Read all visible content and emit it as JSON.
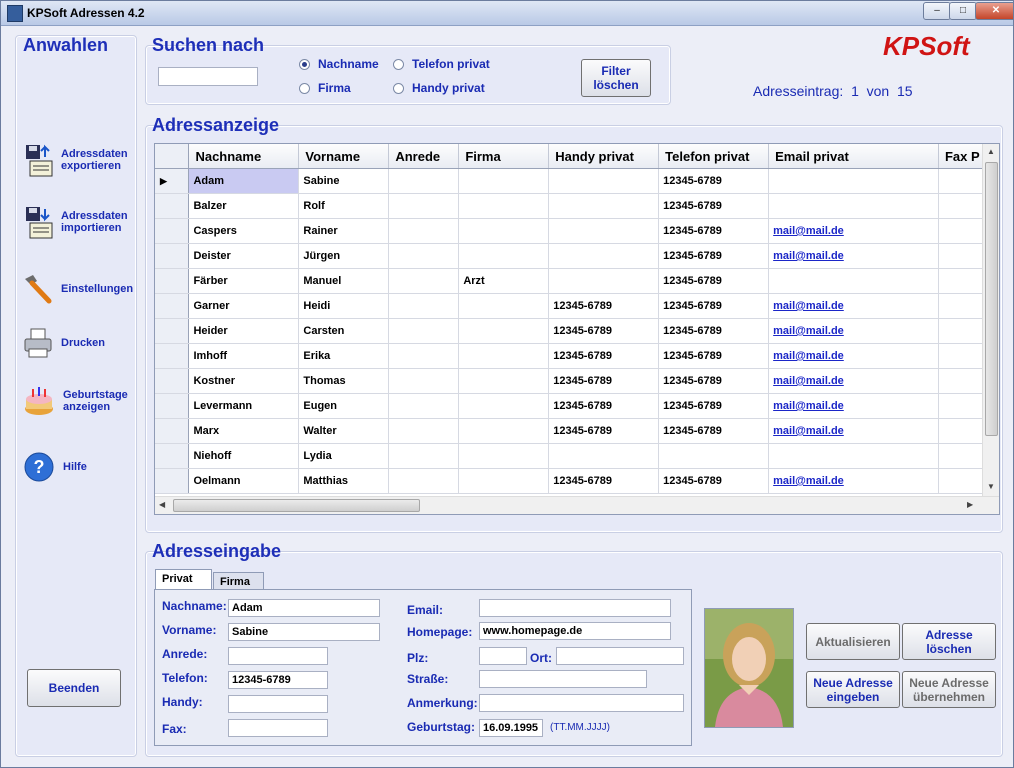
{
  "window": {
    "title": "KPSoft Adressen 4.2",
    "minimize": "–",
    "maximize": "□",
    "close": "✕"
  },
  "sidebar": {
    "title": "Anwahlen",
    "items": [
      {
        "label": "Adressdaten\nexportieren",
        "icon": "export-icon"
      },
      {
        "label": "Adressdaten\nimportieren",
        "icon": "import-icon"
      },
      {
        "label": "Einstellungen",
        "icon": "hammer-icon"
      },
      {
        "label": "Drucken",
        "icon": "printer-icon"
      },
      {
        "label": "Geburtstage\nanzeigen",
        "icon": "birthday-cake-icon"
      },
      {
        "label": "Hilfe",
        "icon": "help-icon"
      }
    ],
    "exit_label": "Beenden"
  },
  "search": {
    "title": "Suchen nach",
    "value": "",
    "radios": [
      {
        "label": "Nachname",
        "checked": true
      },
      {
        "label": "Telefon privat",
        "checked": false
      },
      {
        "label": "Firma",
        "checked": false
      },
      {
        "label": "Handy privat",
        "checked": false
      }
    ],
    "filter_clear_label": "Filter\nlöschen"
  },
  "brand": {
    "logo": "KPSoft",
    "color": "#d01414"
  },
  "record": {
    "label": "Adresseintrag:",
    "current": "1",
    "of_label": "von",
    "total": "15"
  },
  "display": {
    "title": "Adressanzeige",
    "columns": [
      "Nachname",
      "Vorname",
      "Anrede",
      "Firma",
      "Handy privat",
      "Telefon privat",
      "Email privat",
      "Fax P"
    ],
    "rows": [
      [
        "Adam",
        "Sabine",
        "",
        "",
        "",
        "12345-6789",
        "",
        ""
      ],
      [
        "Balzer",
        "Rolf",
        "",
        "",
        "",
        "12345-6789",
        "",
        ""
      ],
      [
        "Caspers",
        "Rainer",
        "",
        "",
        "",
        "12345-6789",
        "mail@mail.de",
        ""
      ],
      [
        "Deister",
        "Jürgen",
        "",
        "",
        "",
        "12345-6789",
        "mail@mail.de",
        ""
      ],
      [
        "Färber",
        "Manuel",
        "",
        "Arzt",
        "",
        "12345-6789",
        "",
        ""
      ],
      [
        "Garner",
        "Heidi",
        "",
        "",
        "12345-6789",
        "12345-6789",
        "mail@mail.de",
        ""
      ],
      [
        "Heider",
        "Carsten",
        "",
        "",
        "12345-6789",
        "12345-6789",
        "mail@mail.de",
        ""
      ],
      [
        "Imhoff",
        "Erika",
        "",
        "",
        "12345-6789",
        "12345-6789",
        "mail@mail.de",
        ""
      ],
      [
        "Kostner",
        "Thomas",
        "",
        "",
        "12345-6789",
        "12345-6789",
        "mail@mail.de",
        ""
      ],
      [
        "Levermann",
        "Eugen",
        "",
        "",
        "12345-6789",
        "12345-6789",
        "mail@mail.de",
        ""
      ],
      [
        "Marx",
        "Walter",
        "",
        "",
        "12345-6789",
        "12345-6789",
        "mail@mail.de",
        ""
      ],
      [
        "Niehoff",
        "Lydia",
        "",
        "",
        "",
        "",
        "",
        ""
      ],
      [
        "Oelmann",
        "Matthias",
        "",
        "",
        "12345-6789",
        "12345-6789",
        "mail@mail.de",
        ""
      ]
    ]
  },
  "entry": {
    "title": "Adresseingabe",
    "tabs": [
      "Privat",
      "Firma"
    ],
    "labels": {
      "nachname": "Nachname:",
      "vorname": "Vorname:",
      "anrede": "Anrede:",
      "telefon": "Telefon:",
      "handy": "Handy:",
      "fax": "Fax:",
      "email": "Email:",
      "homepage": "Homepage:",
      "plz": "Plz:",
      "ort": "Ort:",
      "strasse": "Straße:",
      "anmerkung": "Anmerkung:",
      "geburtstag": "Geburtstag:"
    },
    "values": {
      "nachname": "Adam",
      "vorname": "Sabine",
      "anrede": "",
      "telefon": "12345-6789",
      "handy": "",
      "fax": "",
      "email": "",
      "homepage": "www.homepage.de",
      "plz": "",
      "ort": "",
      "strasse": "",
      "anmerkung": "",
      "geburtstag": "16.09.1995"
    },
    "date_hint": "(TT.MM.JJJJ)",
    "buttons": {
      "update": "Aktualisieren",
      "delete": "Adresse\nlöschen",
      "new": "Neue Adresse\neingeben",
      "apply": "Neue Adresse\nübernehmen"
    }
  }
}
